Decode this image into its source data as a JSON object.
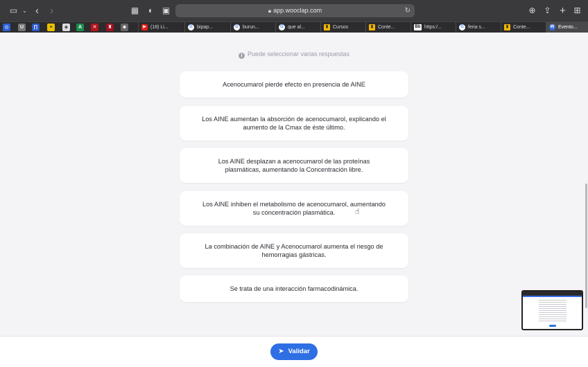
{
  "browser": {
    "url": "app.wooclap.com"
  },
  "tabs": [
    {
      "label": "(18) Li...",
      "icon": "youtube-icon",
      "color": "#e62117",
      "glyph": "▶"
    },
    {
      "label": "bipap...",
      "icon": "google-icon",
      "color": "#ffffff",
      "glyph": "G"
    },
    {
      "label": "burun...",
      "icon": "google-icon",
      "color": "#ffffff",
      "glyph": "G"
    },
    {
      "label": "que al...",
      "icon": "google-icon",
      "color": "#ffffff",
      "glyph": "G"
    },
    {
      "label": "Cursos",
      "icon": "chart-icon",
      "color": "#f2b705",
      "glyph": "▮"
    },
    {
      "label": "Conte...",
      "icon": "chart-icon",
      "color": "#f2b705",
      "glyph": "▮"
    },
    {
      "label": "https:/...",
      "icon": "bb-icon",
      "color": "#ffffff",
      "glyph": "Bb"
    },
    {
      "label": "feria s...",
      "icon": "google-icon",
      "color": "#ffffff",
      "glyph": "G"
    },
    {
      "label": "Conte...",
      "icon": "chart-icon",
      "color": "#f2b705",
      "glyph": "▮"
    },
    {
      "label": "Evento...",
      "icon": "wooclap-icon",
      "color": "#3a6ee8",
      "glyph": "W"
    }
  ],
  "question": {
    "hint": "Puede seleccionar varias respuestas",
    "options": [
      "Acenocumarol pierde efecto en presencia de AINE",
      "Los AINE aumentan la absorción de acenocumarol, explicando el aumento de la Cmax de éste último.",
      "Los AINE desplazan a acenocumarol de las proteínas plasmáticas, aumentando la Concentración libre.",
      "Los AINE inhiben el metabolismo de acenocumarol, aumentando su concentración plasmática.",
      "La combinación de AINE y Acenocumarol aumenta el riesgo de hemorragias gástricas.",
      "Se trata de una interacción farmacodinámica."
    ],
    "submit_label": "Validar"
  },
  "colors": {
    "accent": "#2f6fe4",
    "background": "#f4f4f6"
  }
}
